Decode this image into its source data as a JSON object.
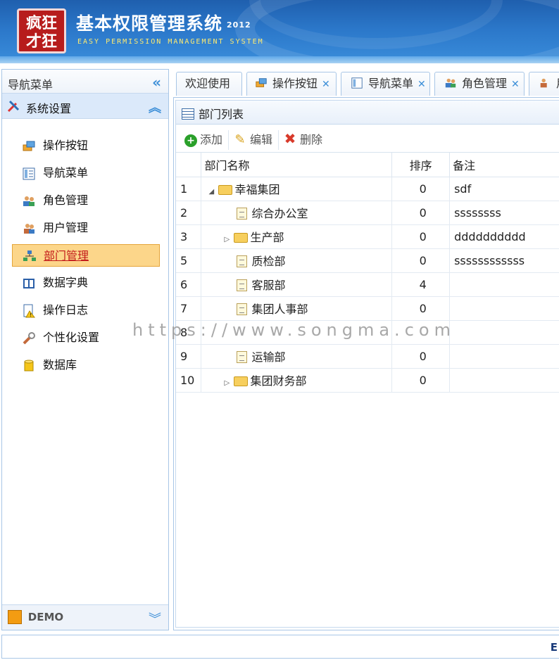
{
  "header": {
    "logo_text": "疯狂\n才狂",
    "title": "基本权限管理系统",
    "year": "2012",
    "subtitle": "EASY PERMISSION MANAGEMENT SYSTEM"
  },
  "sidebar": {
    "title": "导航菜单",
    "section": "系统设置",
    "items": [
      {
        "label": "操作按钮",
        "icon": "button-icon"
      },
      {
        "label": "导航菜单",
        "icon": "nav-menu-icon"
      },
      {
        "label": "角色管理",
        "icon": "role-icon"
      },
      {
        "label": "用户管理",
        "icon": "user-icon"
      },
      {
        "label": "部门管理",
        "icon": "department-icon",
        "active": true
      },
      {
        "label": "数据字典",
        "icon": "dictionary-icon"
      },
      {
        "label": "操作日志",
        "icon": "log-icon"
      },
      {
        "label": "个性化设置",
        "icon": "wrench-icon"
      },
      {
        "label": "数据库",
        "icon": "database-icon"
      }
    ],
    "demo_label": "DEMO"
  },
  "tabs": [
    {
      "label": "欢迎使用",
      "closable": false
    },
    {
      "label": "操作按钮",
      "closable": true
    },
    {
      "label": "导航菜单",
      "closable": true
    },
    {
      "label": "角色管理",
      "closable": true
    },
    {
      "label": "用",
      "closable": false
    }
  ],
  "panel": {
    "title": "部门列表",
    "toolbar": {
      "add": "添加",
      "edit": "编辑",
      "delete": "删除"
    },
    "columns": [
      "部门名称",
      "排序",
      "备注"
    ],
    "rows": [
      {
        "num": "1",
        "name": "幸福集团",
        "order": "0",
        "remark": "sdf"
      },
      {
        "num": "2",
        "name": "综合办公室",
        "order": "0",
        "remark": "ssssssss"
      },
      {
        "num": "3",
        "name": "生产部",
        "order": "0",
        "remark": "dddddddddd"
      },
      {
        "num": "5",
        "name": "质检部",
        "order": "0",
        "remark": "ssssssssssss"
      },
      {
        "num": "6",
        "name": "客服部",
        "order": "4",
        "remark": ""
      },
      {
        "num": "7",
        "name": "集团人事部",
        "order": "0",
        "remark": ""
      },
      {
        "num": "8",
        "name": "",
        "order": "",
        "remark": ""
      },
      {
        "num": "9",
        "name": "运输部",
        "order": "0",
        "remark": ""
      },
      {
        "num": "10",
        "name": "集团财务部",
        "order": "0",
        "remark": ""
      }
    ]
  },
  "watermark": "https://www.songma.com",
  "footer": {
    "text": "E"
  }
}
